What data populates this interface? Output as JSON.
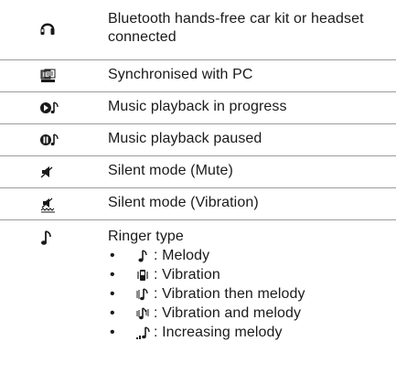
{
  "rows": [
    {
      "icon": "bluetooth-headset-icon",
      "text": "Bluetooth hands-free car kit or headset connected"
    },
    {
      "icon": "pc-sync-icon",
      "text": "Synchronised with PC"
    },
    {
      "icon": "music-playing-icon",
      "text": "Music playback in progress"
    },
    {
      "icon": "music-paused-icon",
      "text": "Music playback paused"
    },
    {
      "icon": "speaker-mute-icon",
      "text": "Silent mode (Mute)"
    },
    {
      "icon": "speaker-vibrate-icon",
      "text": "Silent mode (Vibration)"
    },
    {
      "icon": "music-note-icon",
      "text": "Ringer type"
    }
  ],
  "ringer_types": [
    {
      "bullet": "•",
      "icon": "melody-note-icon",
      "label": ": Melody"
    },
    {
      "bullet": "•",
      "icon": "vibration-phone-icon",
      "label": ": Vibration"
    },
    {
      "bullet": "•",
      "icon": "vibration-then-melody-icon",
      "label": ": Vibration then melody"
    },
    {
      "bullet": "•",
      "icon": "vibration-and-melody-icon",
      "label": ": Vibration and melody"
    },
    {
      "bullet": "•",
      "icon": "increasing-melody-icon",
      "label": ": Increasing melody"
    }
  ]
}
